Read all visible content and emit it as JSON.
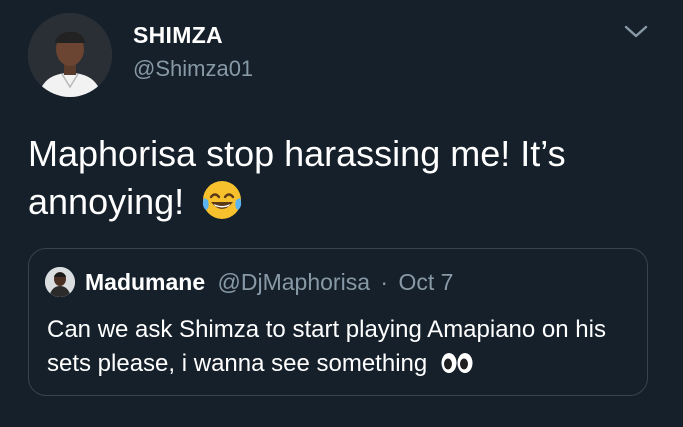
{
  "author": {
    "display_name": "SHIMZA",
    "handle": "@Shimza01",
    "avatar_icon": "profile-photo"
  },
  "menu": {
    "icon": "chevron-down-icon"
  },
  "tweet": {
    "text": "Maphorisa stop harassing me! It’s annoying!",
    "emoji": "face-with-tears-of-joy"
  },
  "quoted_tweet": {
    "display_name": "Madumane",
    "handle": "@DjMaphorisa",
    "separator": "·",
    "date": "Oct 7",
    "text": "Can we ask Shimza to start playing Amapiano on his sets please, i wanna see something",
    "emoji": "eyes"
  },
  "colors": {
    "background": "#15202b",
    "text": "#ffffff",
    "secondary_text": "#8899a6",
    "border": "#38444d"
  }
}
